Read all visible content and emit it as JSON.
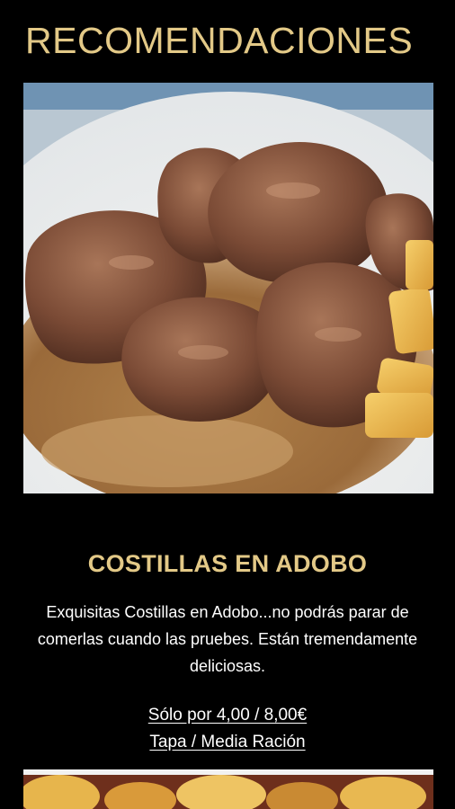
{
  "section": {
    "title": "RECOMENDACIONES"
  },
  "recommendation": {
    "image_alt": "Costillas en adobo",
    "name": "COSTILLAS EN ADOBO",
    "description": "Exquisitas Costillas en Adobo...no podrás parar de comerlas cuando las pruebes. Están tremendamente deliciosas.",
    "price": "Sólo por 4,00 / 8,00€",
    "portion": "Tapa / Media Ración"
  },
  "next_recommendation": {
    "image_alt": "Next dish photo"
  },
  "colors": {
    "background": "#000000",
    "accent_gold": "#e3c987",
    "text": "#ffffff"
  }
}
